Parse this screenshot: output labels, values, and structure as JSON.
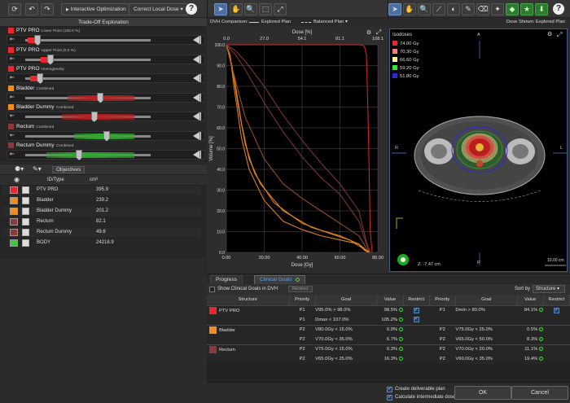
{
  "left_toolbar": {
    "interactive_optimization": "Interactive Optimization",
    "correct_local_dose": "Correct Local Dose",
    "help": "?"
  },
  "tradeoff": {
    "title": "Trade-Off Exploration",
    "rows": [
      {
        "name": "PTV PRO",
        "sub": "Lower Point (100.0 %)",
        "color": "#e8282c",
        "fill_color": "#e8282c",
        "value": 0.1
      },
      {
        "name": "PTV PRO",
        "sub": "Upper Point (0.0 %)",
        "color": "#e8282c",
        "fill_color": "#e8282c",
        "value": 0.2
      },
      {
        "name": "PTV PRO",
        "sub": "Homogeneity",
        "color": "#e8282c",
        "fill_color": "#e8282c",
        "value": 0.12
      },
      {
        "name": "Bladder",
        "sub": "Combined",
        "color": "#f28c1b",
        "fill_color": "#b51f1f",
        "value": 0.6
      },
      {
        "name": "Bladder Dummy",
        "sub": "Combined",
        "color": "#f28c1b",
        "fill_color": "#b51f1f",
        "value": 0.55
      },
      {
        "name": "Rectum",
        "sub": "Combined",
        "color": "#8a3a3a",
        "fill_color": "#2ea82e",
        "value": 0.65
      },
      {
        "name": "Rectum Dummy",
        "sub": "Combined",
        "color": "#8a3a3a",
        "fill_color": "#2ea82e",
        "value": 0.43
      }
    ]
  },
  "structures": {
    "objectives_btn": "Objectives",
    "col_id": "ID/Type",
    "col_vol": "cm³",
    "rows": [
      {
        "name": "PTV PRO",
        "volume": "395.9",
        "color": "#e8282c",
        "icon": "ptv-icon"
      },
      {
        "name": "Bladder",
        "volume": "239.2",
        "color": "#f28c1b",
        "icon": "organ-icon"
      },
      {
        "name": "Bladder Dummy",
        "volume": "201.2",
        "color": "#f28c1b",
        "icon": "organ-icon"
      },
      {
        "name": "Rectum",
        "volume": "82.1",
        "color": "#8a3a3a",
        "icon": "organ-icon"
      },
      {
        "name": "Rectum Dummy",
        "volume": "49.6",
        "color": "#8a3a3a",
        "icon": "organ-icon"
      },
      {
        "name": "BODY",
        "volume": "24218.9",
        "color": "#38c838",
        "icon": "body-icon"
      }
    ]
  },
  "dvh": {
    "comparison_label": "DVH Comparison:",
    "explored_plan": "Explored Plan",
    "balanced_plan": "Balanced Plan ▾"
  },
  "chart_data": {
    "type": "line",
    "title": "",
    "xlabel": "Dose [Gy]",
    "ylabel": "Volume [%]",
    "top_label": "Dose [%]",
    "xlim": [
      0,
      80
    ],
    "ylim": [
      0,
      100
    ],
    "x_ticks": [
      "0.00",
      "20.00",
      "40.00",
      "60.00",
      "80.00"
    ],
    "top_ticks": [
      "0.0",
      "27.0",
      "54.1",
      "81.1",
      "108.1"
    ],
    "y_ticks": [
      "0.0",
      "10.0",
      "20.0",
      "30.0",
      "40.0",
      "50.0",
      "60.0",
      "70.0",
      "80.0",
      "90.0",
      "100.0"
    ],
    "grid": true,
    "series": [
      {
        "color": "#e8282c",
        "x": [
          0,
          70,
          72,
          73,
          74,
          75,
          76,
          77
        ],
        "y": [
          100,
          100,
          99.8,
          99,
          95,
          60,
          10,
          0
        ]
      },
      {
        "color": "#f28c1b",
        "x": [
          0,
          2,
          4,
          8,
          12,
          20,
          30,
          40,
          50,
          60,
          70,
          73,
          75
        ],
        "y": [
          100,
          95,
          80,
          55,
          40,
          25,
          15,
          11,
          8,
          6,
          4,
          1,
          0
        ]
      },
      {
        "color": "#f28c1b",
        "x": [
          0,
          3,
          6,
          10,
          15,
          25,
          40,
          55,
          65,
          72,
          75
        ],
        "y": [
          100,
          90,
          72,
          52,
          38,
          24,
          14,
          9,
          6,
          2,
          0
        ]
      },
      {
        "color": "#f28c1b",
        "x": [
          0,
          4,
          8,
          12,
          18,
          30,
          45,
          60,
          70,
          74,
          76
        ],
        "y": [
          100,
          85,
          62,
          45,
          33,
          20,
          12,
          8,
          4,
          1,
          0
        ]
      },
      {
        "color": "#a5562a",
        "x": [
          0,
          5,
          10,
          20,
          30,
          40,
          50,
          60,
          70,
          74,
          76
        ],
        "y": [
          100,
          82,
          65,
          45,
          33,
          26,
          20,
          14,
          8,
          2,
          0
        ]
      },
      {
        "color": "#8a3a3a",
        "x": [
          0,
          5,
          10,
          20,
          30,
          40,
          50,
          60,
          70,
          74,
          76
        ],
        "y": [
          100,
          95,
          88,
          72,
          58,
          46,
          36,
          28,
          15,
          4,
          0
        ]
      },
      {
        "color": "#8a3a3a",
        "x": [
          0,
          5,
          10,
          20,
          30,
          40,
          50,
          60,
          70,
          74,
          76
        ],
        "y": [
          100,
          97,
          92,
          80,
          66,
          54,
          43,
          33,
          20,
          5,
          0
        ]
      }
    ]
  },
  "ct_view": {
    "dose_shown_label": "Dose Shown: Explored Plan",
    "isodoses_label": "Isodoses",
    "isodoses": [
      {
        "label": "74.00 Gy",
        "color": "#e8282c"
      },
      {
        "label": "70.30 Gy",
        "color": "#ff7a7a"
      },
      {
        "label": "66.60 Gy",
        "color": "#fff59a"
      },
      {
        "label": "59.20 Gy",
        "color": "#2ee82e"
      },
      {
        "label": "51.80 Gy",
        "color": "#2b2bd8"
      }
    ],
    "orient_a": "A",
    "orient_p": "P",
    "orient_r": "R",
    "orient_l": "L",
    "z_readout": "Z: -7.47 cm",
    "scale": "10.00 cm"
  },
  "bottom_tabs": {
    "progress": "Progress",
    "clinical_goals": "Clinical Goals"
  },
  "goals": {
    "show_label": "Show Clinical Goals in DVH",
    "restrict_btn": "Restrict",
    "sort_label": "Sort by",
    "sort_value": "Structure",
    "headers": [
      "Structure",
      "Priority",
      "Goal",
      "Value",
      "Restrict",
      "Priority",
      "Goal",
      "Value",
      "Restrict"
    ],
    "groups": [
      {
        "structure": "PTV PRO",
        "color": "#e8282c",
        "rows": [
          {
            "p1": "P1",
            "g1": "V95.0% > 98.0%",
            "v1": "98.5%",
            "r1": true,
            "p2": "P1",
            "g2": "Dmin > 80.0%",
            "v2": "84.1%",
            "r2": true
          },
          {
            "p1": "P1",
            "g1": "Dmax < 107.0%",
            "v1": "105.2%",
            "r1": true,
            "p2": "",
            "g2": "",
            "v2": "",
            "r2": false
          }
        ]
      },
      {
        "structure": "Bladder",
        "color": "#f28c1b",
        "rows": [
          {
            "p1": "P2",
            "g1": "V80.0Gy < 15.0%",
            "v1": "0.0%",
            "r1": false,
            "p2": "P2",
            "g2": "V75.0Gy < 25.0%",
            "v2": "0.5%",
            "r2": false
          },
          {
            "p1": "P2",
            "g1": "V70.0Gy < 35.0%",
            "v1": "6.7%",
            "r1": false,
            "p2": "P2",
            "g2": "V65.0Gy < 50.0%",
            "v2": "8.3%",
            "r2": false
          }
        ]
      },
      {
        "structure": "Rectum",
        "color": "#8a3a3a",
        "rows": [
          {
            "p1": "P2",
            "g1": "V75.0Gy < 15.0%",
            "v1": "0.3%",
            "r1": false,
            "p2": "P2",
            "g2": "V70.0Gy < 20.0%",
            "v2": "11.1%",
            "r2": false
          },
          {
            "p1": "P2",
            "g1": "V65.0Gy < 25.0%",
            "v1": "16.3%",
            "r1": false,
            "p2": "P2",
            "g2": "V60.0Gy < 35.0%",
            "v2": "19.4%",
            "r2": false
          }
        ]
      }
    ]
  },
  "footer": {
    "create_deliverable": "Create deliverable plan",
    "calculate_intermediate": "Calculate intermediate dose",
    "ok": "OK",
    "cancel": "Cancel"
  }
}
